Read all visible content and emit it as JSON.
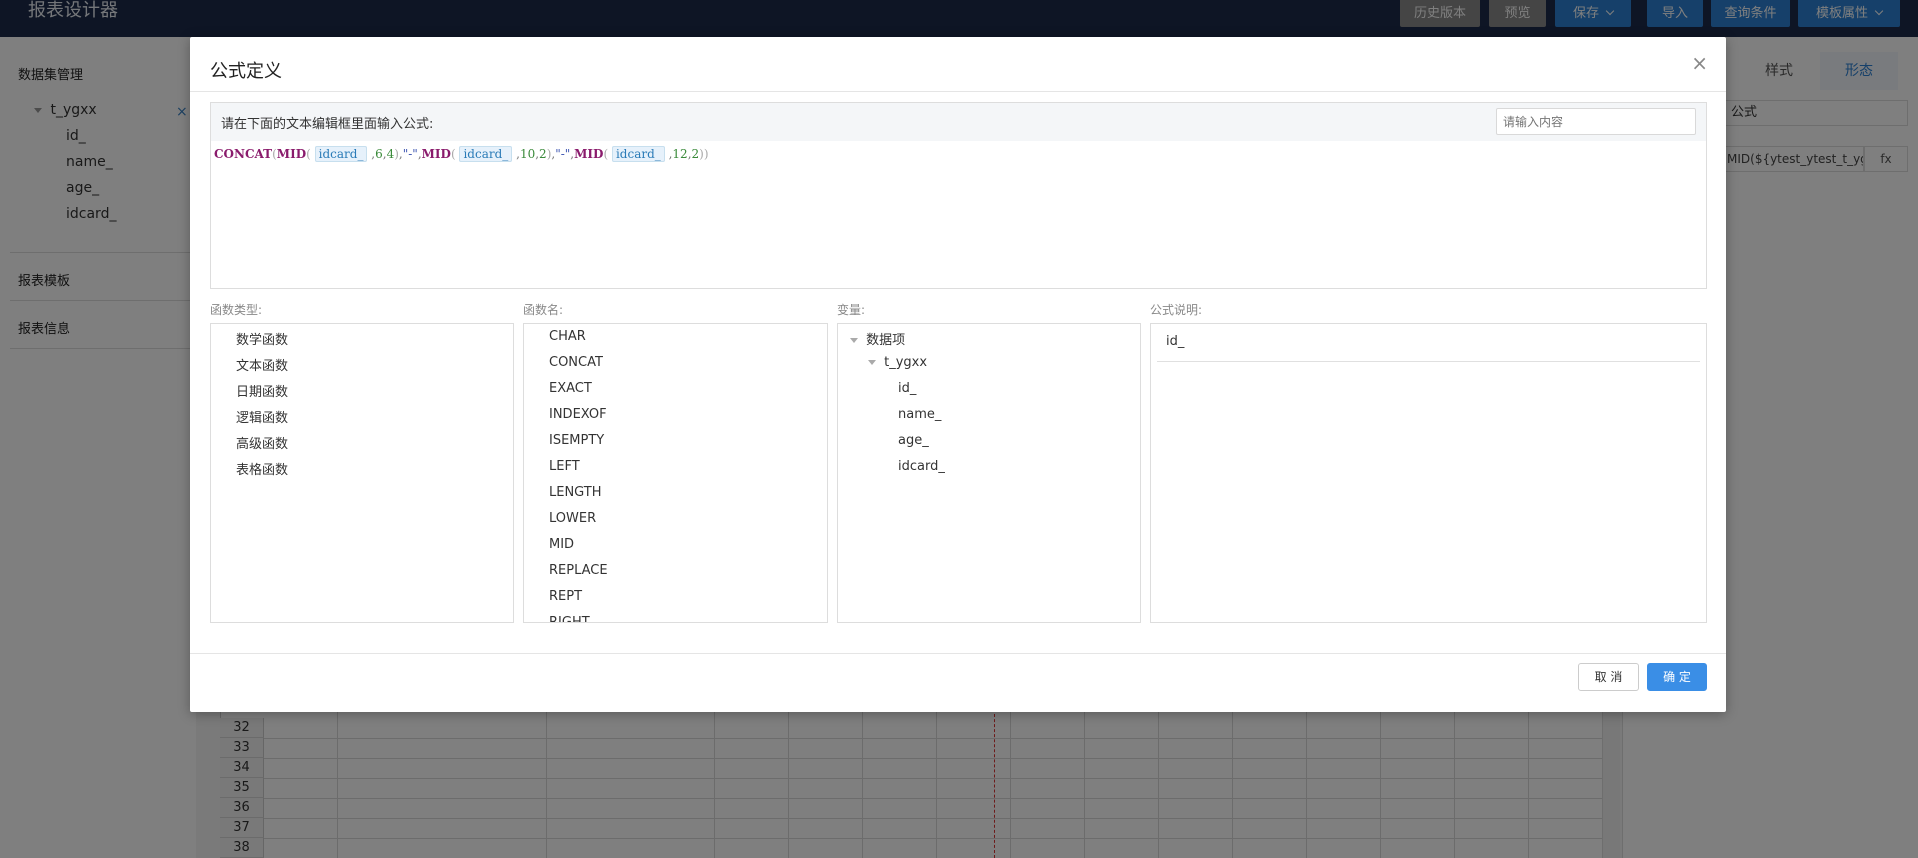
{
  "app": {
    "title": "报表设计器"
  },
  "toolbar": {
    "history": "历史版本",
    "preview": "预览",
    "save": "保存",
    "import": "导入",
    "query": "查询条件",
    "template_props": "模板属性"
  },
  "sidebar": {
    "dataset_title": "数据集管理",
    "dataset_name": "t_ygxx",
    "fields": [
      "id_",
      "name_",
      "age_",
      "idcard_"
    ],
    "report_template": "报表模板",
    "report_info": "报表信息"
  },
  "sheet": {
    "row_numbers": [
      "32",
      "33",
      "34",
      "35",
      "36",
      "37",
      "38"
    ]
  },
  "right_panel": {
    "tab_style": "样式",
    "tab_form": "形态",
    "select_value": "公式",
    "formula_preview": "MID(${ytest_ytest_t_ygxx.i",
    "fx_label": "fx"
  },
  "dialog": {
    "title": "公式定义",
    "close_icon": "×",
    "hint": "请在下面的文本编辑框里面输入公式:",
    "search_placeholder": "请输入内容",
    "formula": {
      "concat": "CONCAT",
      "mid": "MID",
      "ref": "idcard_",
      "n1": "6",
      "n2": "4",
      "n3": "10",
      "n4": "2",
      "n5": "12",
      "n6": "2",
      "dash": "\"-\""
    },
    "labels": {
      "func_type": "函数类型:",
      "func_name": "函数名:",
      "variables": "变量:",
      "description": "公式说明:"
    },
    "func_types": [
      "数学函数",
      "文本函数",
      "日期函数",
      "逻辑函数",
      "高级函数",
      "表格函数"
    ],
    "func_names": [
      "CHAR",
      "CONCAT",
      "EXACT",
      "INDEXOF",
      "ISEMPTY",
      "LEFT",
      "LENGTH",
      "LOWER",
      "MID",
      "REPLACE",
      "REPT",
      "RIGHT"
    ],
    "variables": {
      "root": "数据项",
      "dataset": "t_ygxx",
      "fields": [
        "id_",
        "name_",
        "age_",
        "idcard_"
      ]
    },
    "description_value": "id_",
    "cancel": "取 消",
    "ok": "确 定"
  },
  "colors": {
    "topbar": "#1c2b4a",
    "accent": "#3a8ee6",
    "function_keyword": "#8a1b6c"
  }
}
